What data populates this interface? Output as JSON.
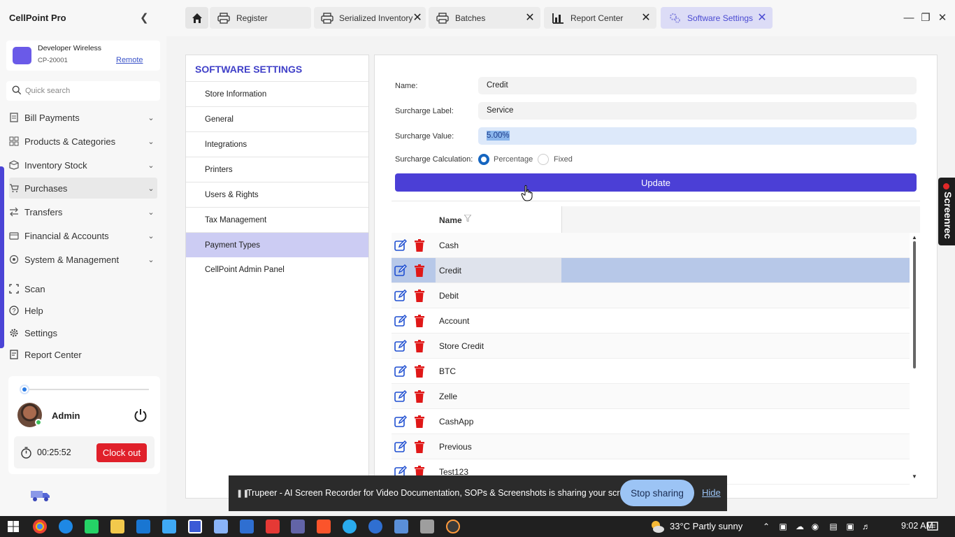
{
  "app": {
    "title": "CellPoint Pro"
  },
  "store": {
    "name": "Developer Wireless",
    "id": "CP-20001",
    "remote_label": "Remote"
  },
  "search": {
    "placeholder": "Quick search"
  },
  "nav": {
    "items": [
      {
        "label": "Bill Payments"
      },
      {
        "label": "Products & Categories"
      },
      {
        "label": "Inventory Stock"
      },
      {
        "label": "Purchases"
      },
      {
        "label": "Transfers"
      },
      {
        "label": "Financial & Accounts"
      },
      {
        "label": "System & Management"
      }
    ],
    "links": [
      {
        "label": "Scan"
      },
      {
        "label": "Help"
      },
      {
        "label": "Settings"
      },
      {
        "label": "Report Center"
      }
    ]
  },
  "user": {
    "name": "Admin",
    "timer": "00:25:52",
    "clockout_label": "Clock out"
  },
  "tabs": [
    {
      "label": "Register"
    },
    {
      "label": "Serialized Inventory"
    },
    {
      "label": "Batches"
    },
    {
      "label": "Report Center"
    },
    {
      "label": "Software Settings"
    }
  ],
  "settings_menu": {
    "title": "SOFTWARE SETTINGS",
    "items": [
      {
        "label": "Store Information"
      },
      {
        "label": "General"
      },
      {
        "label": "Integrations"
      },
      {
        "label": "Printers"
      },
      {
        "label": "Users & Rights"
      },
      {
        "label": "Tax Management"
      },
      {
        "label": "Payment Types"
      },
      {
        "label": "CellPoint Admin Panel"
      }
    ],
    "active_index": 6
  },
  "form": {
    "name_label": "Name:",
    "name_value": "Credit",
    "surcharge_label_label": "Surcharge Label:",
    "surcharge_label_value": "Service",
    "surcharge_value_label": "Surcharge Value:",
    "surcharge_value_value": "5.00%",
    "calc_label": "Surcharge Calculation:",
    "calc_options": [
      "Percentage",
      "Fixed"
    ],
    "calc_selected": "Percentage",
    "update_label": "Update"
  },
  "grid": {
    "column_name": "Name",
    "rows": [
      "Cash",
      "Credit",
      "Debit",
      "Account",
      "Store Credit",
      "BTC",
      "Zelle",
      "CashApp",
      "Previous",
      "Test123"
    ],
    "selected_index": 1
  },
  "screenrec": {
    "label": "Screenrec"
  },
  "share_bar": {
    "text": "Trupeer - AI Screen Recorder for Video Documentation, SOPs & Screenshots is sharing your screen.",
    "stop_label": "Stop sharing",
    "hide_label": "Hide"
  },
  "taskbar": {
    "weather": "33°C  Partly sunny",
    "time": "9:02 AM"
  },
  "colors": {
    "accent": "#4b3fd6",
    "danger": "#e0202a",
    "selected_row": "#b7c8e8",
    "active_menu": "#ccccf3"
  }
}
